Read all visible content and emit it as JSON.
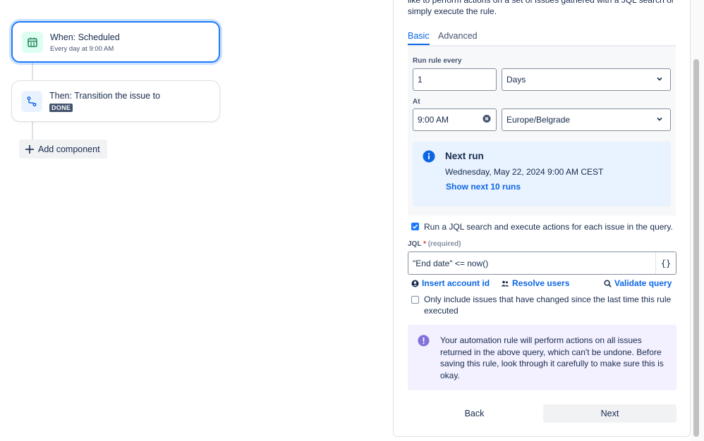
{
  "flow": {
    "trigger": {
      "title": "When: Scheduled",
      "subtitle": "Every day at 9:00 AM"
    },
    "action": {
      "title": "Then: Transition the issue to",
      "status": "DONE"
    },
    "add_component_label": "Add component"
  },
  "panel": {
    "intro_line1": "like to perform actions on a set of issues gathered with a JQL search or",
    "intro_line2": "simply execute the rule.",
    "tabs": [
      {
        "label": "Basic",
        "active": true
      },
      {
        "label": "Advanced",
        "active": false
      }
    ],
    "schedule": {
      "run_every_label": "Run rule every",
      "run_every_value": "1",
      "unit_value": "Days",
      "at_label": "At",
      "time_value": "9:00 AM",
      "timezone_value": "Europe/Belgrade"
    },
    "next_run": {
      "title": "Next run",
      "datetime": "Wednesday, May 22, 2024 9:00 AM CEST",
      "show_more": "Show next 10 runs"
    },
    "jql_checkbox": {
      "label": "Run a JQL search and execute actions for each issue in the query.",
      "checked": true
    },
    "jql": {
      "label": "JQL",
      "required_marker": "*",
      "required_hint": "(required)",
      "value": "\"End date\" <= now()",
      "braces": "{}"
    },
    "jql_links": {
      "insert_account": "Insert account id",
      "resolve_users": "Resolve users",
      "validate": "Validate query"
    },
    "changed_checkbox": {
      "line1": "Only include issues that have changed since the last time this rule",
      "line2": "executed",
      "checked": false
    },
    "warning": {
      "line1": "Your automation rule will perform actions on all issues",
      "line2": "returned in the above query, which can't be undone. Before",
      "line3": "saving this rule, look through it carefully to make sure this is",
      "line4": "okay."
    },
    "buttons": {
      "back": "Back",
      "next": "Next"
    }
  },
  "colors": {
    "accent": "#0c66e4",
    "trigger_icon_bg": "#dcfff1",
    "trigger_icon": "#1f845a",
    "action_icon_bg": "#e9f2ff",
    "action_icon": "#0c66e4",
    "info_bg": "#e9f2ff",
    "warn_bg": "#f3f0ff",
    "warn_icon": "#8270db"
  },
  "icons": {
    "trigger": "calendar-icon",
    "action": "transition-icon",
    "add": "plus-icon",
    "info": "info-icon",
    "warning": "exclamation-icon",
    "account": "person-circle-icon",
    "users": "users-icon",
    "validate": "search-icon"
  }
}
